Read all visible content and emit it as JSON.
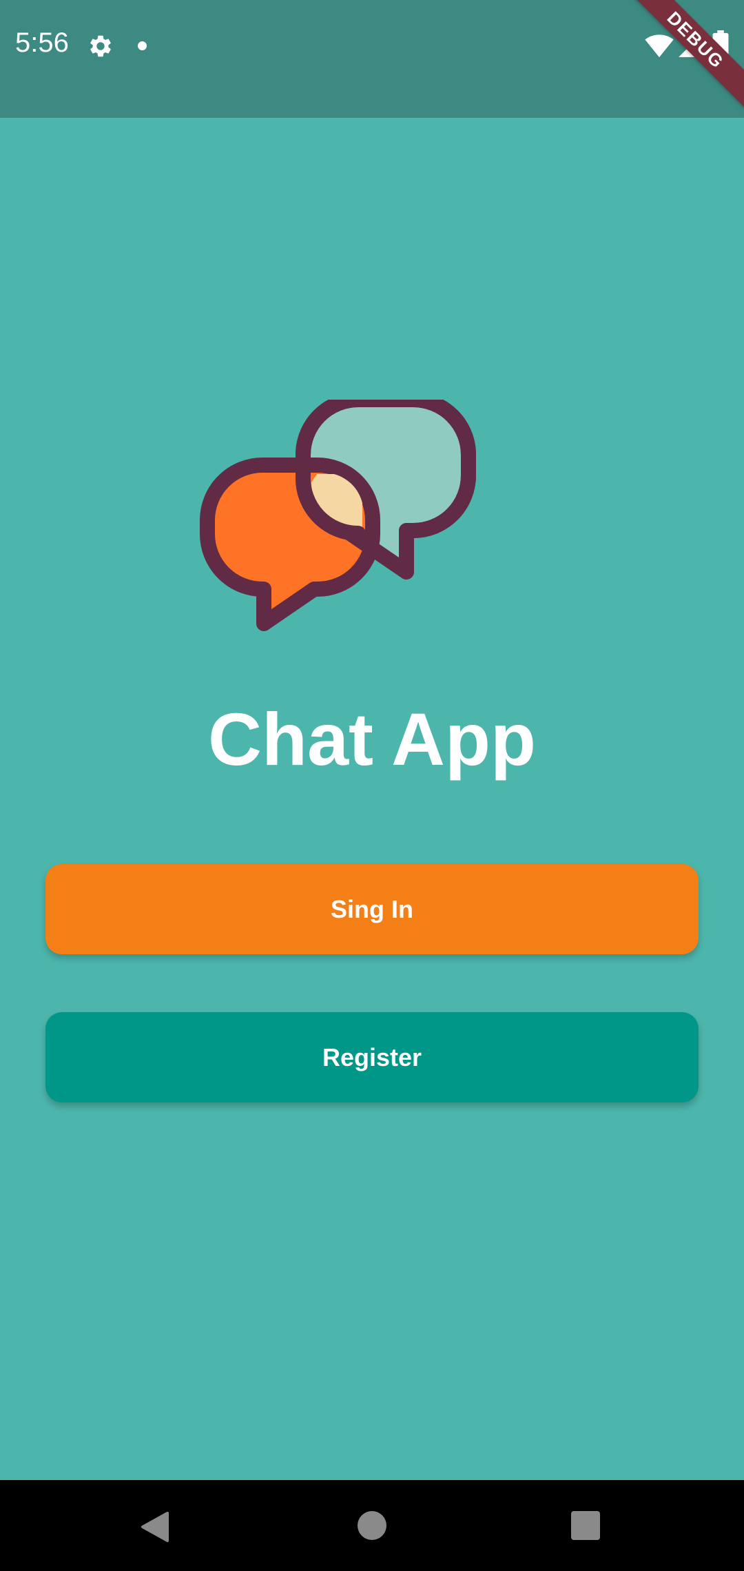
{
  "status_bar": {
    "time": "5:56",
    "icons": [
      "gear-icon",
      "notification-dot-icon",
      "wifi-icon",
      "signal-icon",
      "battery-icon"
    ],
    "background_color": "#3d8a82"
  },
  "debug_banner": {
    "label": "DEBUG",
    "color": "#7a2f3c"
  },
  "welcome": {
    "logo_icon": "chat-bubbles-icon",
    "title": "Chat App",
    "background_color": "#4db6ac"
  },
  "actions": {
    "sign_in_label": "Sing In",
    "sign_in_color": "#f57f17",
    "register_label": "Register",
    "register_color": "#009688"
  },
  "nav_bar": {
    "icons": [
      "back-icon",
      "home-icon",
      "recents-icon"
    ]
  }
}
